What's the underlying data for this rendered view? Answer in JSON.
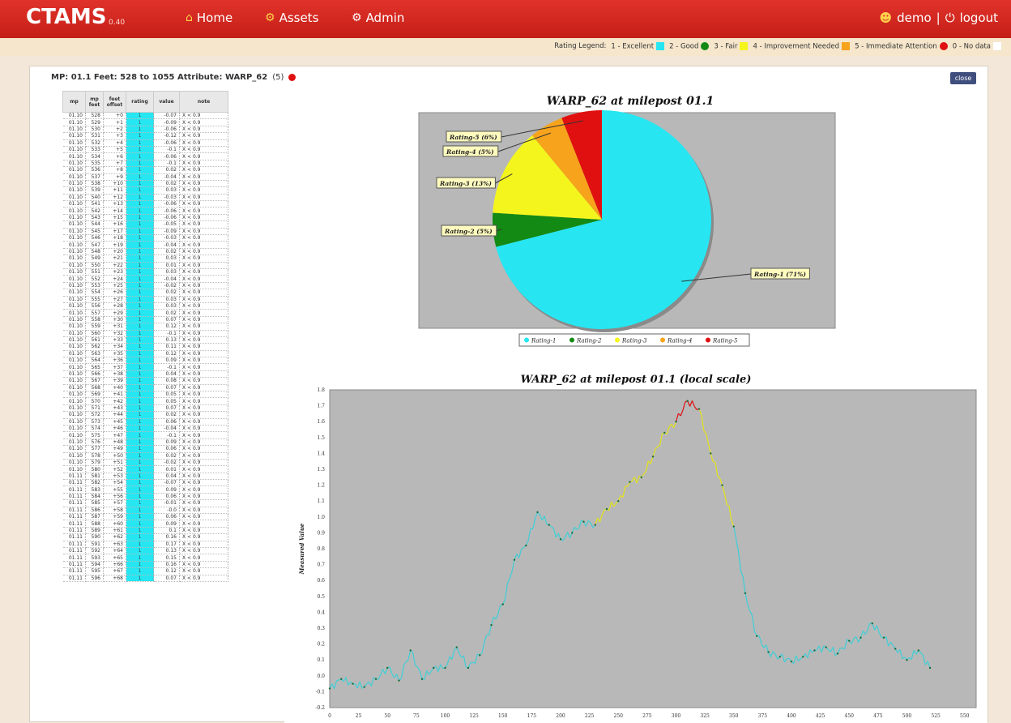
{
  "app": {
    "brand": "CTAMS",
    "version": "0.40"
  },
  "nav": {
    "home": "Home",
    "assets": "Assets",
    "admin": "Admin"
  },
  "user": {
    "name": "demo",
    "separator": "|",
    "logout": "logout"
  },
  "legend": {
    "prefix": "Rating Legend:",
    "items": [
      {
        "label": "1 - Excellent",
        "color": "#27e6f2",
        "shape": "square"
      },
      {
        "label": "2 - Good",
        "color": "#138a13",
        "shape": "circle"
      },
      {
        "label": "3 - Fair",
        "color": "#f5f51e",
        "shape": "square"
      },
      {
        "label": "4 - Improvement Needed",
        "color": "#f7a31c",
        "shape": "square"
      },
      {
        "label": "5 - Immediate Attention",
        "color": "#e01010",
        "shape": "circle"
      },
      {
        "label": "0 - No data",
        "color": "#ffffff",
        "shape": "square"
      }
    ]
  },
  "panel": {
    "header": "MP: 01.1   Feet: 528 to 1055   Attribute: WARP_62",
    "rating_badge": "(5)",
    "close_label": "close"
  },
  "table": {
    "headers": [
      "mp",
      "mp feet",
      "feet offset",
      "rating",
      "value",
      "note"
    ],
    "rows": [
      [
        "01.10",
        "528",
        "+0",
        "1",
        "-0.07",
        "X < 0.9"
      ],
      [
        "01.10",
        "529",
        "+1",
        "1",
        "-0.09",
        "X < 0.9"
      ],
      [
        "01.10",
        "530",
        "+2",
        "1",
        "-0.06",
        "X < 0.9"
      ],
      [
        "01.10",
        "531",
        "+3",
        "1",
        "-0.12",
        "X < 0.9"
      ],
      [
        "01.10",
        "532",
        "+4",
        "1",
        "-0.06",
        "X < 0.9"
      ],
      [
        "01.10",
        "533",
        "+5",
        "1",
        "-0.1",
        "X < 0.9"
      ],
      [
        "01.10",
        "534",
        "+6",
        "1",
        "-0.06",
        "X < 0.9"
      ],
      [
        "01.10",
        "535",
        "+7",
        "1",
        "-0.1",
        "X < 0.9"
      ],
      [
        "01.10",
        "536",
        "+8",
        "1",
        "0.02",
        "X < 0.9"
      ],
      [
        "01.10",
        "537",
        "+9",
        "1",
        "-0.04",
        "X < 0.9"
      ],
      [
        "01.10",
        "538",
        "+10",
        "1",
        "0.02",
        "X < 0.9"
      ],
      [
        "01.10",
        "539",
        "+11",
        "1",
        "0.03",
        "X < 0.9"
      ],
      [
        "01.10",
        "540",
        "+12",
        "1",
        "-0.03",
        "X < 0.9"
      ],
      [
        "01.10",
        "541",
        "+13",
        "1",
        "-0.06",
        "X < 0.9"
      ],
      [
        "01.10",
        "542",
        "+14",
        "1",
        "-0.06",
        "X < 0.9"
      ],
      [
        "01.10",
        "543",
        "+15",
        "1",
        "-0.06",
        "X < 0.9"
      ],
      [
        "01.10",
        "544",
        "+16",
        "1",
        "-0.05",
        "X < 0.9"
      ],
      [
        "01.10",
        "545",
        "+17",
        "1",
        "-0.09",
        "X < 0.9"
      ],
      [
        "01.10",
        "546",
        "+18",
        "1",
        "-0.03",
        "X < 0.9"
      ],
      [
        "01.10",
        "547",
        "+19",
        "1",
        "-0.04",
        "X < 0.9"
      ],
      [
        "01.10",
        "548",
        "+20",
        "1",
        "0.02",
        "X < 0.9"
      ],
      [
        "01.10",
        "549",
        "+21",
        "1",
        "0.03",
        "X < 0.9"
      ],
      [
        "01.10",
        "550",
        "+22",
        "1",
        "0.01",
        "X < 0.9"
      ],
      [
        "01.10",
        "551",
        "+23",
        "1",
        "0.03",
        "X < 0.9"
      ],
      [
        "01.10",
        "552",
        "+24",
        "1",
        "-0.04",
        "X < 0.9"
      ],
      [
        "01.10",
        "553",
        "+25",
        "1",
        "-0.02",
        "X < 0.9"
      ],
      [
        "01.10",
        "554",
        "+26",
        "1",
        "0.02",
        "X < 0.9"
      ],
      [
        "01.10",
        "555",
        "+27",
        "1",
        "0.03",
        "X < 0.9"
      ],
      [
        "01.10",
        "556",
        "+28",
        "1",
        "0.03",
        "X < 0.9"
      ],
      [
        "01.10",
        "557",
        "+29",
        "1",
        "0.02",
        "X < 0.9"
      ],
      [
        "01.10",
        "558",
        "+30",
        "1",
        "0.07",
        "X < 0.9"
      ],
      [
        "01.10",
        "559",
        "+31",
        "1",
        "0.12",
        "X < 0.9"
      ],
      [
        "01.10",
        "560",
        "+32",
        "1",
        "-0.1",
        "X < 0.9"
      ],
      [
        "01.10",
        "561",
        "+33",
        "1",
        "0.13",
        "X < 0.9"
      ],
      [
        "01.10",
        "562",
        "+34",
        "1",
        "0.11",
        "X < 0.9"
      ],
      [
        "01.10",
        "563",
        "+35",
        "1",
        "0.12",
        "X < 0.9"
      ],
      [
        "01.10",
        "564",
        "+36",
        "1",
        "0.09",
        "X < 0.9"
      ],
      [
        "01.10",
        "565",
        "+37",
        "1",
        "-0.1",
        "X < 0.9"
      ],
      [
        "01.10",
        "566",
        "+38",
        "1",
        "0.04",
        "X < 0.9"
      ],
      [
        "01.10",
        "567",
        "+39",
        "1",
        "0.08",
        "X < 0.9"
      ],
      [
        "01.10",
        "568",
        "+40",
        "1",
        "0.07",
        "X < 0.9"
      ],
      [
        "01.10",
        "569",
        "+41",
        "1",
        "0.05",
        "X < 0.9"
      ],
      [
        "01.10",
        "570",
        "+42",
        "1",
        "0.05",
        "X < 0.9"
      ],
      [
        "01.10",
        "571",
        "+43",
        "1",
        "0.07",
        "X < 0.9"
      ],
      [
        "01.10",
        "572",
        "+44",
        "1",
        "0.02",
        "X < 0.9"
      ],
      [
        "01.10",
        "573",
        "+45",
        "1",
        "0.06",
        "X < 0.9"
      ],
      [
        "01.10",
        "574",
        "+46",
        "1",
        "-0.04",
        "X < 0.9"
      ],
      [
        "01.10",
        "575",
        "+47",
        "1",
        "-0.1",
        "X < 0.9"
      ],
      [
        "01.10",
        "576",
        "+48",
        "1",
        "0.09",
        "X < 0.9"
      ],
      [
        "01.10",
        "577",
        "+49",
        "1",
        "0.06",
        "X < 0.9"
      ],
      [
        "01.10",
        "578",
        "+50",
        "1",
        "0.02",
        "X < 0.9"
      ],
      [
        "01.10",
        "579",
        "+51",
        "1",
        "-0.02",
        "X < 0.9"
      ],
      [
        "01.10",
        "580",
        "+52",
        "1",
        "0.01",
        "X < 0.9"
      ],
      [
        "01.11",
        "581",
        "+53",
        "1",
        "0.04",
        "X < 0.9"
      ],
      [
        "01.11",
        "582",
        "+54",
        "1",
        "-0.07",
        "X < 0.9"
      ],
      [
        "01.11",
        "583",
        "+55",
        "1",
        "0.09",
        "X < 0.9"
      ],
      [
        "01.11",
        "584",
        "+56",
        "1",
        "0.06",
        "X < 0.9"
      ],
      [
        "01.11",
        "585",
        "+57",
        "1",
        "-0.01",
        "X < 0.9"
      ],
      [
        "01.11",
        "586",
        "+58",
        "1",
        "-0.0",
        "X < 0.9"
      ],
      [
        "01.11",
        "587",
        "+59",
        "1",
        "0.06",
        "X < 0.9"
      ],
      [
        "01.11",
        "588",
        "+60",
        "1",
        "0.09",
        "X < 0.9"
      ],
      [
        "01.11",
        "589",
        "+61",
        "1",
        "0.1",
        "X < 0.9"
      ],
      [
        "01.11",
        "590",
        "+62",
        "1",
        "0.16",
        "X < 0.9"
      ],
      [
        "01.11",
        "591",
        "+63",
        "1",
        "0.17",
        "X < 0.9"
      ],
      [
        "01.11",
        "592",
        "+64",
        "1",
        "0.13",
        "X < 0.9"
      ],
      [
        "01.11",
        "593",
        "+65",
        "1",
        "0.15",
        "X < 0.9"
      ],
      [
        "01.11",
        "594",
        "+66",
        "1",
        "0.16",
        "X < 0.9"
      ],
      [
        "01.11",
        "595",
        "+67",
        "1",
        "0.12",
        "X < 0.9"
      ],
      [
        "01.11",
        "596",
        "+68",
        "1",
        "0.07",
        "X < 0.9"
      ]
    ]
  },
  "chart_data": [
    {
      "type": "pie",
      "title": "WARP_62 at milepost 01.1",
      "categories": [
        "Rating-1",
        "Rating-2",
        "Rating-3",
        "Rating-4",
        "Rating-5"
      ],
      "slice_labels": [
        "Rating-1 (71%)",
        "Rating-2 (5%)",
        "Rating-3 (13%)",
        "Rating-4 (5%)",
        "Rating-5 (6%)"
      ],
      "values": [
        71,
        5,
        13,
        5,
        6
      ],
      "colors": [
        "#27e6f2",
        "#138a13",
        "#f5f51e",
        "#f7a31c",
        "#e01010"
      ],
      "legend": [
        "Rating-1",
        "Rating-2",
        "Rating-3",
        "Rating-4",
        "Rating-5"
      ],
      "legend_position": "bottom",
      "background": "#b8b8b8"
    },
    {
      "type": "line",
      "title": "WARP_62 at milepost 01.1 (local scale)",
      "ylabel": "Measured Value",
      "xlabel": "",
      "xlim": [
        0,
        530
      ],
      "ylim": [
        -0.2,
        1.8
      ],
      "xticks": [
        0,
        25,
        50,
        75,
        100,
        125,
        150,
        175,
        200,
        225,
        250,
        275,
        300,
        325,
        350,
        375,
        400,
        425,
        450,
        475,
        500,
        525,
        550
      ],
      "yticks": [
        "-0.2",
        "-0.1",
        "0.0",
        "0.1",
        "0.2",
        "0.3",
        "0.4",
        "0.5",
        "0.6",
        "0.7",
        "0.8",
        "0.9",
        "1.0",
        "1.1",
        "1.2",
        "1.3",
        "1.4",
        "1.5",
        "1.6",
        "1.7",
        "1.8"
      ],
      "background": "#b8b8b8",
      "rating_colors": {
        "1": "#3fcfd6",
        "2": "#138a13",
        "3": "#e3e31a",
        "4": "#f7a31c",
        "5": "#e01010"
      },
      "x": [
        0,
        10,
        20,
        30,
        40,
        50,
        60,
        70,
        80,
        90,
        100,
        110,
        120,
        130,
        140,
        150,
        160,
        170,
        180,
        190,
        200,
        210,
        220,
        230,
        240,
        250,
        260,
        270,
        280,
        290,
        300,
        310,
        320,
        330,
        340,
        350,
        360,
        370,
        380,
        390,
        400,
        410,
        420,
        430,
        440,
        450,
        460,
        470,
        480,
        490,
        500,
        510,
        520
      ],
      "values": [
        -0.08,
        -0.02,
        -0.05,
        -0.07,
        -0.02,
        0.05,
        -0.03,
        0.16,
        -0.02,
        0.05,
        0.05,
        0.18,
        0.05,
        0.13,
        0.32,
        0.45,
        0.73,
        0.82,
        1.03,
        0.95,
        0.86,
        0.9,
        0.97,
        0.95,
        1.05,
        1.1,
        1.22,
        1.25,
        1.38,
        1.53,
        1.6,
        1.73,
        1.68,
        1.4,
        1.2,
        0.94,
        0.52,
        0.25,
        0.15,
        0.12,
        0.09,
        0.12,
        0.16,
        0.18,
        0.14,
        0.22,
        0.24,
        0.33,
        0.24,
        0.17,
        0.1,
        0.16,
        0.05
      ]
    }
  ]
}
